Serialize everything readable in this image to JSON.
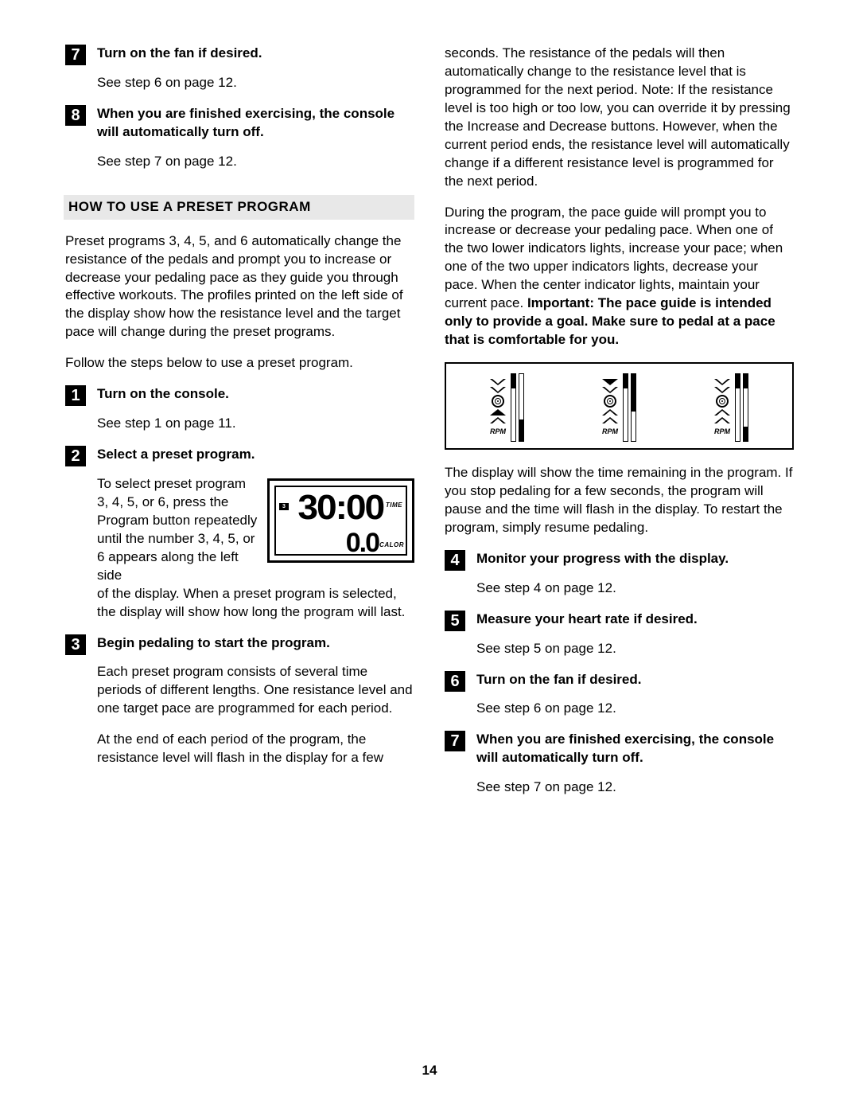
{
  "page_number": "14",
  "left": {
    "step7": {
      "title": "Turn on the fan if desired.",
      "body": "See step 6 on page 12."
    },
    "step8": {
      "title": "When you are finished exercising, the console will automatically turn off.",
      "body": "See step 7 on page 12."
    },
    "section_heading": "HOW TO USE A PRESET PROGRAM",
    "intro1": "Preset programs 3, 4, 5, and 6 automatically change the resistance of the pedals and prompt you to increase or decrease your pedaling pace as they guide you through effective workouts. The profiles printed on the left side of the display show how the resistance level and the target pace will change during the preset programs.",
    "intro2": "Follow the steps below to use a preset program.",
    "step1": {
      "title": "Turn on the console.",
      "body": "See step 1 on page 11."
    },
    "step2": {
      "title": "Select a preset program.",
      "body1": "To select preset program 3, 4, 5, or 6, press the Program button repeatedly until the number 3, 4, 5, or 6 appears along the left side",
      "body2": "of the display. When a preset program is selected, the display will show how long the program will last.",
      "lcd": {
        "prog": "3",
        "time": "30:00",
        "time_label": "TIME",
        "calor": "0.0",
        "calor_label": "CALOR"
      }
    },
    "step3": {
      "title": "Begin pedaling to start the program.",
      "body1": "Each preset program consists of several time periods of different lengths. One resistance level and one target pace are programmed for each period.",
      "body2": "At the end of each period of the program, the resistance level will flash in the display for a few"
    }
  },
  "right": {
    "cont1": "seconds. The resistance of the pedals will then automatically change to the resistance level that is programmed for the next period. Note: If the resistance level is too high or too low, you can override it by pressing the Increase and Decrease buttons. However, when the current period ends, the resistance level will automatically change if a different resistance level is programmed for the next period.",
    "cont2a": "During the program, the pace guide will prompt you to increase or decrease your pedaling pace. When one of the two lower indicators lights, increase your pace; when one of the two upper indicators lights, decrease your pace. When the center indicator lights, maintain your current pace. ",
    "cont2b": "Important: The pace guide is intended only to provide a goal. Make sure to pedal at a pace that is comfortable for you.",
    "rpm_label": "RPM",
    "cont3": "The display will show the time remaining in the program. If you stop pedaling for a few seconds, the program will pause and the time will flash in the display. To restart the program, simply resume pedaling.",
    "step4": {
      "title": "Monitor your progress with the display.",
      "body": "See step 4 on page 12."
    },
    "step5": {
      "title": "Measure your heart rate if desired.",
      "body": "See step 5 on page 12."
    },
    "step6": {
      "title": "Turn on the fan if desired.",
      "body": "See step 6 on page 12."
    },
    "step7": {
      "title": "When you are finished exercising, the console will automatically turn off.",
      "body": "See step 7 on page 12."
    }
  }
}
